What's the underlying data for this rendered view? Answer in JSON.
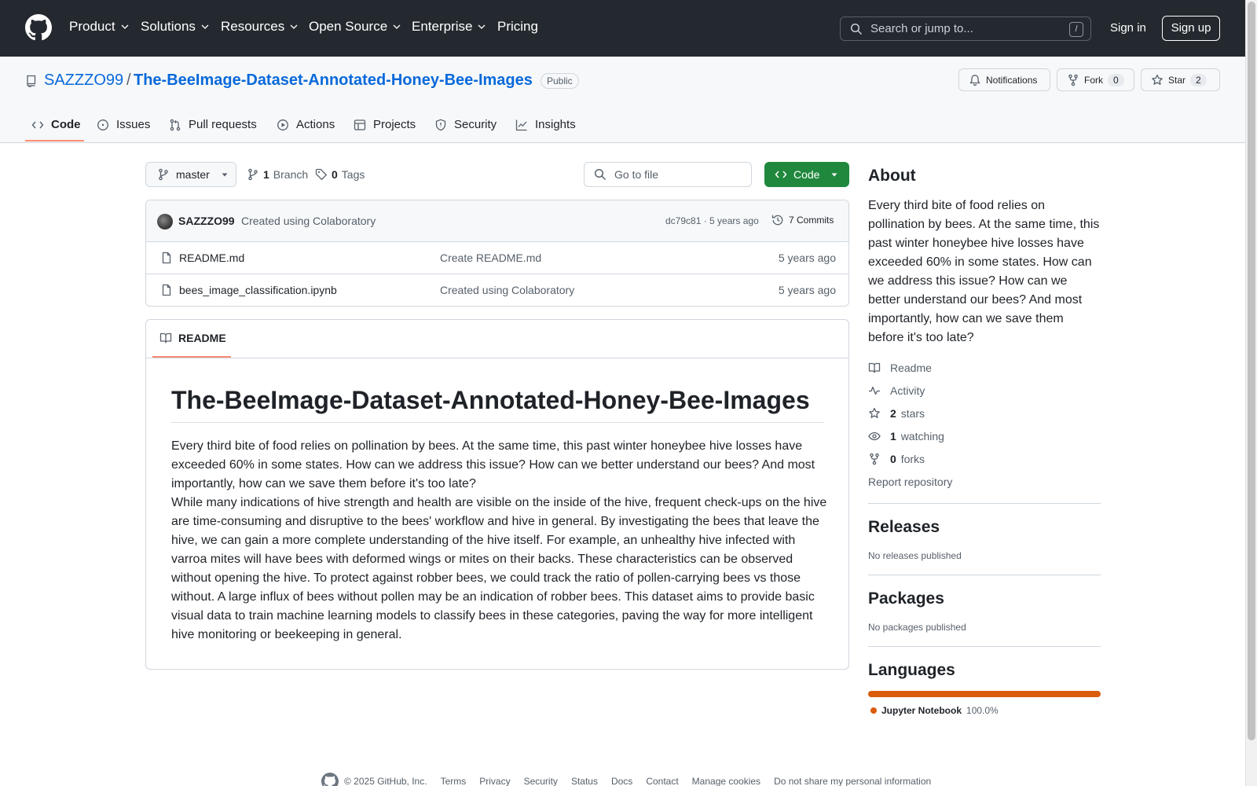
{
  "header": {
    "nav": [
      {
        "label": "Product",
        "has_caret": true
      },
      {
        "label": "Solutions",
        "has_caret": true
      },
      {
        "label": "Resources",
        "has_caret": true
      },
      {
        "label": "Open Source",
        "has_caret": true
      },
      {
        "label": "Enterprise",
        "has_caret": true
      },
      {
        "label": "Pricing",
        "has_caret": false
      }
    ],
    "search_placeholder": "Search or jump to...",
    "search_shortcut": "/",
    "signin": "Sign in",
    "signup": "Sign up"
  },
  "repo": {
    "owner": "SAZZZO99",
    "separator": "/",
    "name": "The-BeeImage-Dataset-Annotated-Honey-Bee-Images",
    "visibility": "Public",
    "notifications_label": "Notifications",
    "fork_label": "Fork",
    "fork_count": "0",
    "star_label": "Star",
    "star_count": "2"
  },
  "tabs": [
    {
      "label": "Code",
      "icon": "code-icon",
      "selected": true
    },
    {
      "label": "Issues",
      "icon": "issue-icon",
      "selected": false
    },
    {
      "label": "Pull requests",
      "icon": "pull-request-icon",
      "selected": false
    },
    {
      "label": "Actions",
      "icon": "play-icon",
      "selected": false
    },
    {
      "label": "Projects",
      "icon": "table-icon",
      "selected": false
    },
    {
      "label": "Security",
      "icon": "shield-icon",
      "selected": false
    },
    {
      "label": "Insights",
      "icon": "graph-icon",
      "selected": false
    }
  ],
  "branch_bar": {
    "branch": "master",
    "branch_count": "1",
    "branch_label": "Branch",
    "tag_count": "0",
    "tag_label": "Tags",
    "goto_placeholder": "Go to file",
    "code_button": "Code"
  },
  "latest_commit": {
    "author": "SAZZZO99",
    "message": "Created using Colaboratory",
    "meta": "dc79c81 · 5 years ago",
    "commits": "7 Commits"
  },
  "files": [
    {
      "name": "README.md",
      "commit": "Create README.md",
      "age": "5 years ago"
    },
    {
      "name": "bees_image_classification.ipynb",
      "commit": "Created using Colaboratory",
      "age": "5 years ago"
    }
  ],
  "readme": {
    "tab_label": "README",
    "title": "The-BeeImage-Dataset-Annotated-Honey-Bee-Images",
    "para1": "Every third bite of food relies on pollination by bees. At the same time, this past winter honeybee hive losses have exceeded 60% in some states. How can we address this issue? How can we better understand our bees? And most importantly, how can we save them before it's too late?",
    "para2": "While many indications of hive strength and health are visible on the inside of the hive, frequent check-ups on the hive are time-consuming and disruptive to the bees' workflow and hive in general. By investigating the bees that leave the hive, we can gain a more complete understanding of the hive itself. For example, an unhealthy hive infected with varroa mites will have bees with deformed wings or mites on their backs. These characteristics can be observed without opening the hive. To protect against robber bees, we could track the ratio of pollen-carrying bees vs those without. A large influx of bees without pollen may be an indication of robber bees. This dataset aims to provide basic visual data to train machine learning models to classify bees in these categories, paving the way for more intelligent hive monitoring or beekeeping in general."
  },
  "about": {
    "title": "About",
    "description": "Every third bite of food relies on pollination by bees. At the same time, this past winter honeybee hive losses have exceeded 60% in some states. How can we address this issue? How can we better understand our bees? And most importantly, how can we save them before it's too late?",
    "readme_link": "Readme",
    "activity_link": "Activity",
    "stars_count": "2",
    "stars_label": "stars",
    "watching_count": "1",
    "watching_label": "watching",
    "forks_count": "0",
    "forks_label": "forks",
    "report": "Report repository"
  },
  "releases": {
    "title": "Releases",
    "empty": "No releases published"
  },
  "packages": {
    "title": "Packages",
    "empty": "No packages published"
  },
  "languages": {
    "title": "Languages",
    "items": [
      {
        "name": "Jupyter Notebook",
        "percent": "100.0%",
        "color": "#da5b0b"
      }
    ]
  },
  "footer": {
    "copyright": "© 2025 GitHub, Inc.",
    "links": [
      "Terms",
      "Privacy",
      "Security",
      "Status",
      "Docs",
      "Contact",
      "Manage cookies",
      "Do not share my personal information"
    ]
  },
  "colors": {
    "header_bg": "#24292f",
    "link": "#0969da",
    "primary_button": "#1f883d",
    "tab_accent": "#fd8c73"
  }
}
